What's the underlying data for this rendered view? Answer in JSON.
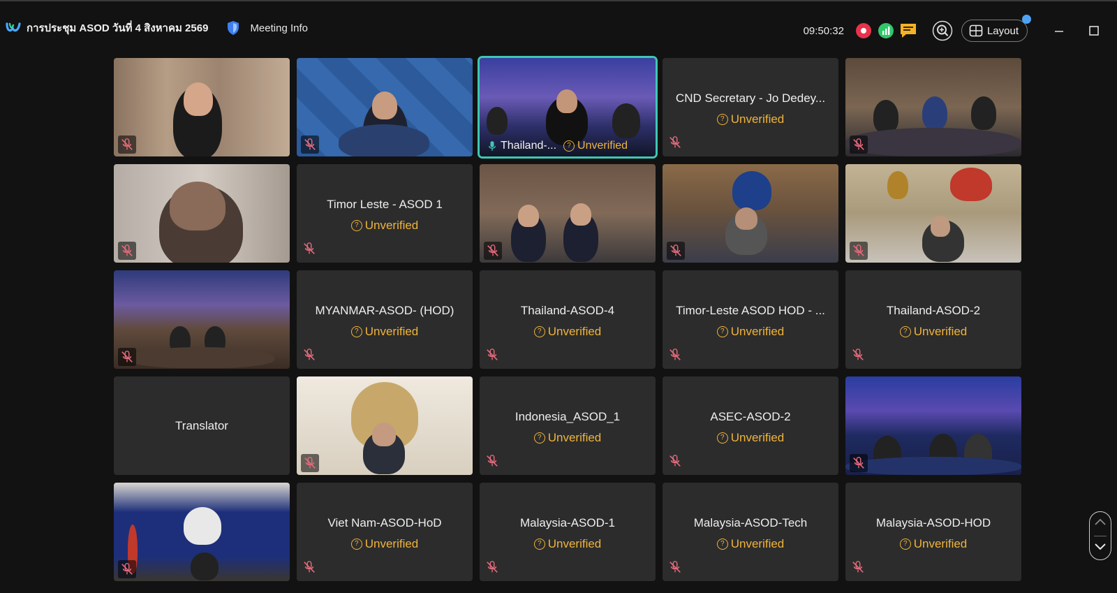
{
  "header": {
    "meeting_title": "การประชุม ASOD วันที่ 4 สิงหาคม 2569",
    "meeting_info": "Meeting Info",
    "time": "09:50:32",
    "layout_label": "Layout"
  },
  "icons": {
    "logo": "webex-logo-icon",
    "shield": "shield-icon",
    "record": "record-icon",
    "stats": "signal-stats-icon",
    "chat": "chat-icon",
    "zoom": "zoom-in-icon",
    "layout": "grid-layout-icon",
    "minimize": "minimize-icon",
    "maximize": "maximize-icon",
    "muted": "microphone-muted-icon",
    "unverified": "question-circle-icon"
  },
  "colors": {
    "accent_active": "#3ec7b5",
    "unverified": "#f0b43c",
    "record": "#e8324b",
    "stats": "#2fc76a",
    "chat": "#f5b227",
    "mute": "#e46a7b"
  },
  "participants": [
    {
      "name": "",
      "status": "",
      "video": true
    },
    {
      "name": "",
      "status": "",
      "video": true
    },
    {
      "name": "Thailand-...",
      "status": "Unverified",
      "video": true,
      "active": true
    },
    {
      "name": "CND Secretary - Jo Dedey...",
      "status": "Unverified",
      "video": false
    },
    {
      "name": "",
      "status": "",
      "video": true
    },
    {
      "name": "",
      "status": "",
      "video": true
    },
    {
      "name": "Timor Leste - ASOD 1",
      "status": "Unverified",
      "video": false
    },
    {
      "name": "",
      "status": "",
      "video": true
    },
    {
      "name": "",
      "status": "",
      "video": true
    },
    {
      "name": "",
      "status": "",
      "video": true
    },
    {
      "name": "",
      "status": "",
      "video": true
    },
    {
      "name": "MYANMAR-ASOD- (HOD)",
      "status": "Unverified",
      "video": false
    },
    {
      "name": "Thailand-ASOD-4",
      "status": "Unverified",
      "video": false
    },
    {
      "name": "Timor-Leste ASOD HOD - ...",
      "status": "Unverified",
      "video": false
    },
    {
      "name": "Thailand-ASOD-2",
      "status": "Unverified",
      "video": false
    },
    {
      "name": "Translator",
      "status": "",
      "video": false
    },
    {
      "name": "",
      "status": "",
      "video": true
    },
    {
      "name": "Indonesia_ASOD_1",
      "status": "Unverified",
      "video": false
    },
    {
      "name": "ASEC-ASOD-2",
      "status": "Unverified",
      "video": false
    },
    {
      "name": "",
      "status": "",
      "video": true
    },
    {
      "name": "",
      "status": "",
      "video": true
    },
    {
      "name": "Viet Nam-ASOD-HoD",
      "status": "Unverified",
      "video": false
    },
    {
      "name": "Malaysia-ASOD-1",
      "status": "Unverified",
      "video": false
    },
    {
      "name": "Malaysia-ASOD-Tech",
      "status": "Unverified",
      "video": false
    },
    {
      "name": "Malaysia-ASOD-HOD",
      "status": "Unverified",
      "video": false
    }
  ]
}
